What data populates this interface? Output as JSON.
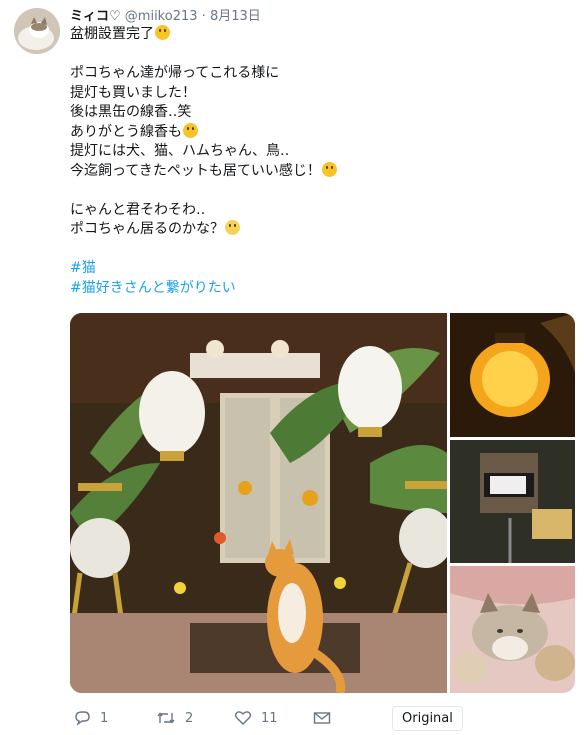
{
  "tweet": {
    "name": "ミィコ♡",
    "handle": "@miiko213",
    "separator": "·",
    "date": "8月13日",
    "lines": [
      {
        "text": "盆棚設置完了",
        "emoji": "wink-emoji"
      },
      {
        "blank": true
      },
      {
        "text": "ポコちゃん達が帰ってこれる様に"
      },
      {
        "text": "提灯も買いました！"
      },
      {
        "text": "後は黒缶の線香‥笑"
      },
      {
        "text": "ありがとう線香も",
        "emoji": "blush-emoji"
      },
      {
        "text": "提灯には犬、猫、ハムちゃん、鳥‥"
      },
      {
        "text": "今迄飼ってきたペットも居ていい感じ！",
        "emoji": "grin-emoji"
      },
      {
        "blank": true
      },
      {
        "text": "にゃんと君そわそわ‥"
      },
      {
        "text": "ポコちゃん居るのかな？",
        "emoji": "eye-roll-emoji"
      },
      {
        "blank": true
      }
    ],
    "hashtags": [
      "#猫",
      "#猫好きさんと繋がりたい"
    ]
  },
  "media": {
    "main_photo": "altar-with-lanterns-and-cat-photo",
    "side_photos": [
      "yellow-lantern-photo",
      "incense-can-photo",
      "tabby-cat-photo"
    ]
  },
  "actions": {
    "reply_count": "1",
    "retweet_count": "2",
    "like_count": "11",
    "original_button": "Original"
  },
  "colors": {
    "text": "#14171a",
    "secondary": "#657786",
    "link": "#1da1f2"
  }
}
